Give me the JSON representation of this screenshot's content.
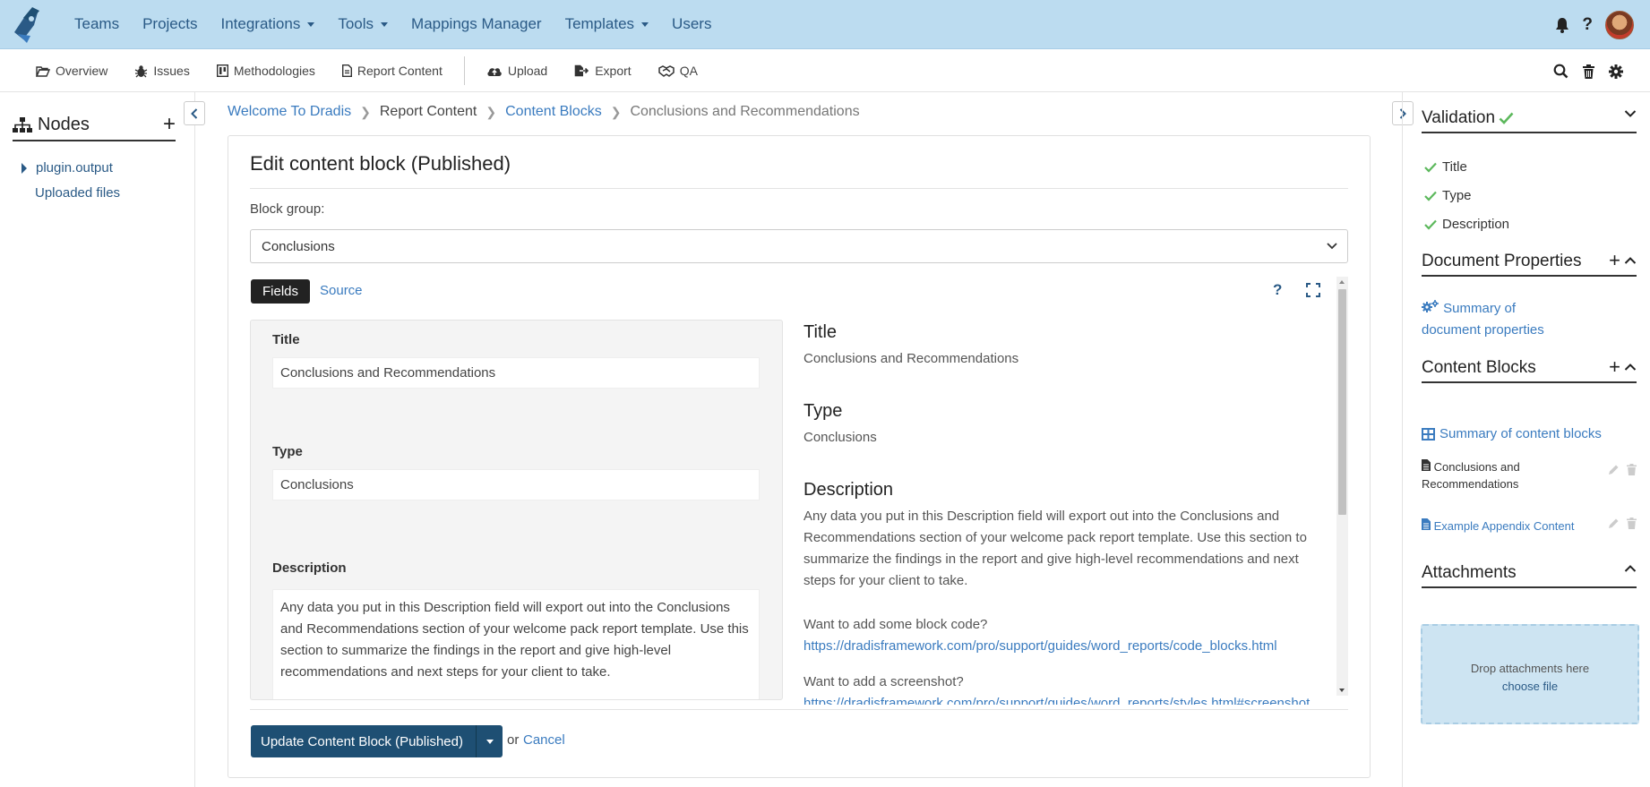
{
  "topnav": {
    "items": [
      {
        "label": "Teams",
        "has_menu": false
      },
      {
        "label": "Projects",
        "has_menu": false
      },
      {
        "label": "Integrations",
        "has_menu": true
      },
      {
        "label": "Tools",
        "has_menu": true
      },
      {
        "label": "Mappings Manager",
        "has_menu": false
      },
      {
        "label": "Templates",
        "has_menu": true
      },
      {
        "label": "Users",
        "has_menu": false
      }
    ],
    "help_label": "?"
  },
  "subnav": {
    "overview": "Overview",
    "issues": "Issues",
    "methodologies": "Methodologies",
    "report_content": "Report Content",
    "upload": "Upload",
    "export": "Export",
    "qa": "QA"
  },
  "left_sidebar": {
    "title": "Nodes",
    "add_label": "+",
    "items": [
      "plugin.output",
      "Uploaded files"
    ]
  },
  "breadcrumb": {
    "home": "Welcome To Dradis",
    "section": "Report Content",
    "subsection": "Content Blocks",
    "current": "Conclusions and Recommendations"
  },
  "editor": {
    "heading": "Edit content block (Published)",
    "block_group_label": "Block group:",
    "block_group_value": "Conclusions",
    "tabs": {
      "fields": "Fields",
      "source": "Source"
    },
    "help_label": "?",
    "fields": {
      "title_label": "Title",
      "title_value": "Conclusions and Recommendations",
      "type_label": "Type",
      "type_value": "Conclusions",
      "description_label": "Description",
      "description_value": "Any data you put in this Description field will export out into the Conclusions and Recommendations section of your welcome pack report template. Use this section to summarize the findings in the report and give high-level recommendations and next steps for your client to take."
    },
    "preview": {
      "title_heading": "Title",
      "title_text": "Conclusions and Recommendations",
      "type_heading": "Type",
      "type_text": "Conclusions",
      "description_heading": "Description",
      "description_text": "Any data you put in this Description field will export out into the Conclusions and Recommendations section of your welcome pack report template. Use this section to summarize the findings in the report and give high-level recommendations and next steps for your client to take.",
      "code_prompt": "Want to add some block code?",
      "code_link": "https://dradisframework.com/pro/support/guides/word_reports/code_blocks.html",
      "screenshot_prompt": "Want to add a screenshot?",
      "screenshot_link": "https://dradisframework.com/pro/support/guides/word_reports/styles.html#screenshot"
    },
    "submit_label": "Update Content Block (Published)",
    "or_text": "or",
    "cancel_label": "Cancel"
  },
  "right_sidebar": {
    "validation": {
      "title": "Validation",
      "checks": [
        "Title",
        "Type",
        "Description"
      ]
    },
    "document_properties": {
      "title": "Document Properties",
      "add_label": "+",
      "summary_link": "Summary of document properties"
    },
    "content_blocks": {
      "title": "Content Blocks",
      "add_label": "+",
      "summary_link": "Summary of content blocks",
      "items": [
        {
          "label": "Conclusions and Recommendations",
          "current": true
        },
        {
          "label": "Example Appendix Content",
          "current": false
        }
      ]
    },
    "attachments": {
      "title": "Attachments",
      "drop_text": "Drop attachments here",
      "choose_label": "choose file"
    }
  },
  "colors": {
    "topnav_bg": "#bcdcf0",
    "link": "#3a7bbf",
    "primary_button": "#1e4f73",
    "success": "#5cb85c",
    "drop_zone": "#cde4f2"
  }
}
